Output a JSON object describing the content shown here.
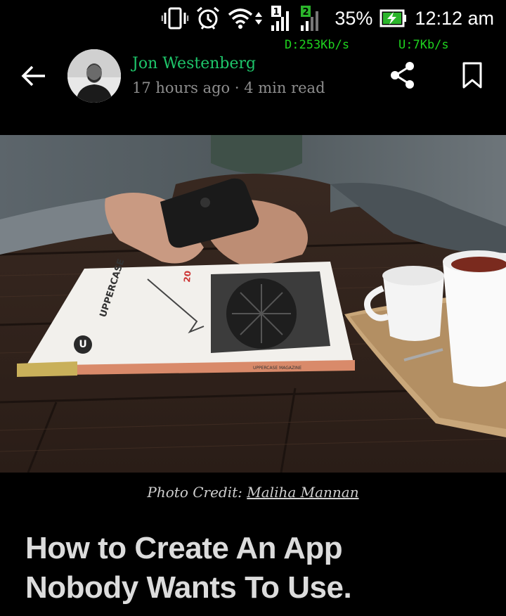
{
  "status_bar": {
    "battery_percent": "35%",
    "time": "12:12 am",
    "sim1_label": "1",
    "sim2_label": "2",
    "download_speed": "D:253Kb/s",
    "upload_speed": "U:7Kb/s"
  },
  "author": {
    "name": "Jon Westenberg",
    "meta": "17 hours ago · 4 min read"
  },
  "hero_image": {
    "magazine_title": "UPPERCASE",
    "magazine_spine": "UPPERCASE MAGAZINE",
    "issue_number": "20"
  },
  "caption": {
    "prefix": "Photo Credit: ",
    "credit_name": "Maliha Mannan"
  },
  "article": {
    "title_line1": "How to Create An App",
    "title_line2": "Nobody Wants To Use."
  },
  "colors": {
    "accent": "#1ec56a",
    "net_speed": "#1fd41f",
    "sim2_badge": "#2bb52b"
  },
  "icons": [
    "vibrate-icon",
    "alarm-icon",
    "wifi-icon",
    "data-arrows-icon",
    "signal-icon",
    "battery-charging-icon",
    "back-arrow-icon",
    "share-icon",
    "bookmark-icon"
  ]
}
